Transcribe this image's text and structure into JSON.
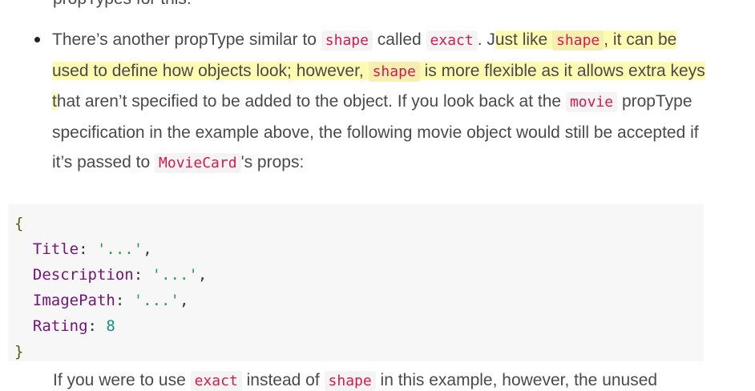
{
  "clipped_top": {
    "text_a": "propTypes",
    "text_b": "for this."
  },
  "bullet": {
    "t1": "There’s another propType similar to ",
    "code_shape": "shape",
    "t2": " called ",
    "code_exact": "exact",
    "t3": ". J",
    "hl1": "ust like ",
    "hl_code_shape_1": "shape",
    "hl2": ", it can be used to define how objects look; however, ",
    "hl_code_shape_2": "shape",
    "hl3": " is more flexible as it allows extra keys t",
    "t4": "hat aren’t specified to be added to the object. If you look back at the ",
    "code_movie": "movie",
    "t5": " propType specification in the example above, the following movie object would still be accepted if it’s passed to ",
    "code_moviecard": "MovieCard",
    "t6": "'s props:"
  },
  "code_block": {
    "open_brace": "{",
    "close_brace": "}",
    "entries": [
      {
        "key": "Title",
        "value": "'...'",
        "value_type": "string",
        "trailing": ","
      },
      {
        "key": "Description",
        "value": "'...'",
        "value_type": "string",
        "trailing": ","
      },
      {
        "key": "ImagePath",
        "value": "'...'",
        "value_type": "string",
        "trailing": ","
      },
      {
        "key": "Rating",
        "value": "8",
        "value_type": "number",
        "trailing": ""
      }
    ]
  },
  "bottom": {
    "t1": "If you were to use ",
    "code_exact": "exact",
    "t2": " instead of ",
    "code_shape": "shape",
    "t3": " in this example, however, the unused"
  },
  "colors": {
    "highlight": "#fffbb3",
    "inline_code_text": "#d6194f",
    "code_block_bg": "#f7f7f7",
    "syntax_key": "#74127a",
    "syntax_string": "#25a046",
    "syntax_number": "#138f8a"
  }
}
